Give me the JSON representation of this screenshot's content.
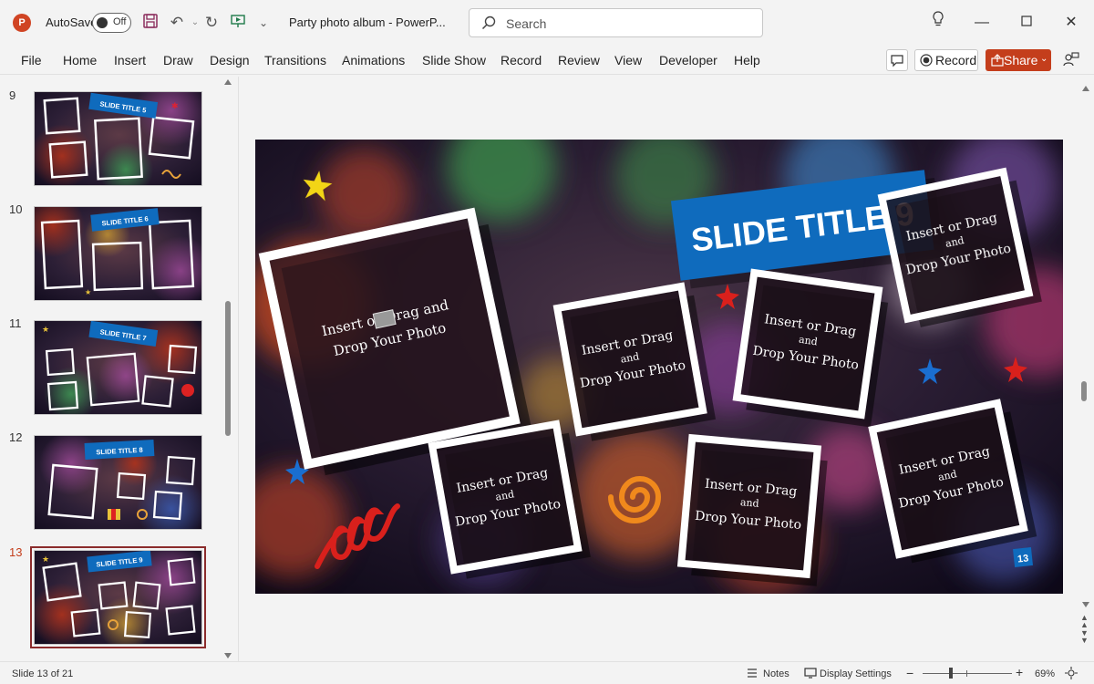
{
  "app": {
    "logo_letter": "P",
    "autosave_label": "AutoSave",
    "autosave_state": "Off",
    "document_title": "Party photo album  -  PowerP...",
    "search_placeholder": "Search",
    "brand_color": "#c43e1c"
  },
  "ribbon": {
    "tabs": [
      "File",
      "Home",
      "Insert",
      "Draw",
      "Design",
      "Transitions",
      "Animations",
      "Slide Show",
      "Record",
      "Review",
      "View",
      "Developer",
      "Help"
    ],
    "record_label": "Record",
    "share_label": "Share"
  },
  "thumbnails": [
    {
      "number": "9",
      "title": "SLIDE TITLE 5",
      "active": false
    },
    {
      "number": "10",
      "title": "SLIDE TITLE 6",
      "active": false
    },
    {
      "number": "11",
      "title": "SLIDE TITLE 7",
      "active": false
    },
    {
      "number": "12",
      "title": "SLIDE TITLE 8",
      "active": false
    },
    {
      "number": "13",
      "title": "SLIDE TITLE 9",
      "active": true
    }
  ],
  "slide": {
    "title": "SLIDE TITLE 9",
    "placeholder_large": [
      "Insert or Drag and",
      "Drop Your Photo"
    ],
    "placeholder_small_line1": "Insert or Drag",
    "placeholder_small_and": "and",
    "placeholder_small_line2": "Drop Your Photo",
    "page_number": "13",
    "title_bar_color": "#0f6bbd"
  },
  "status": {
    "slide_info": "Slide 13 of 21",
    "notes_label": "Notes",
    "display_settings_label": "Display Settings",
    "zoom_minus": "−",
    "zoom_plus": "+",
    "zoom_level": "69%"
  }
}
